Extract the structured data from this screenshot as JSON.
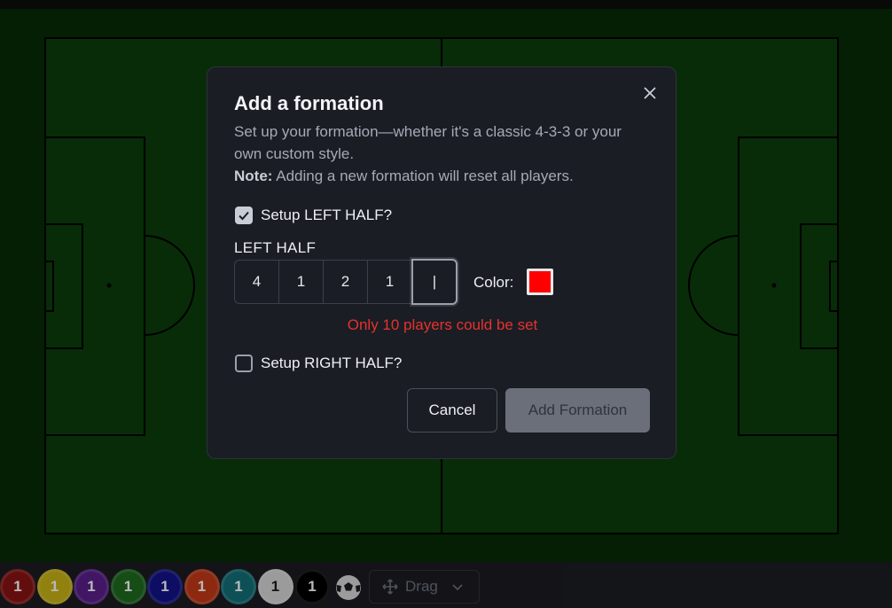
{
  "dialog": {
    "title": "Add a formation",
    "description": "Set up your formation—whether it's a classic 4-3-3 or your own custom style.",
    "note_label": "Note:",
    "note_text": " Adding a new formation will reset all players.",
    "close_glyph": "×",
    "left_half_checkbox": {
      "label": "Setup LEFT HALF?",
      "checked": true
    },
    "left_half_title": "LEFT HALF",
    "formation_slots": [
      "4",
      "1",
      "2",
      "1",
      "|"
    ],
    "color_label": "Color:",
    "color_value": "#ff0000",
    "error_message": "Only 10 players could be set",
    "right_half_checkbox": {
      "label": "Setup RIGHT HALF?",
      "checked": false
    },
    "cancel_label": "Cancel",
    "add_label": "Add Formation"
  },
  "toolbar": {
    "tokens": [
      {
        "label": "1",
        "color": "#8a1414"
      },
      {
        "label": "1",
        "color": "#c9b417"
      },
      {
        "label": "1",
        "color": "#5a1f8c"
      },
      {
        "label": "1",
        "color": "#1f6b21"
      },
      {
        "label": "1",
        "color": "#12148a"
      },
      {
        "label": "1",
        "color": "#c23a17"
      },
      {
        "label": "1",
        "color": "#137078"
      },
      {
        "label": "1",
        "color": "#d7d7d7"
      },
      {
        "label": "1",
        "color": "#000000"
      }
    ],
    "drag_label": "Drag"
  },
  "icons": {
    "close": "close-icon",
    "check": "check-icon",
    "ball": "soccer-ball-icon",
    "move": "move-icon",
    "chevron": "chevron-down-icon"
  },
  "colors": {
    "pitch": "#0c3d0c",
    "error": "#e5322d"
  }
}
